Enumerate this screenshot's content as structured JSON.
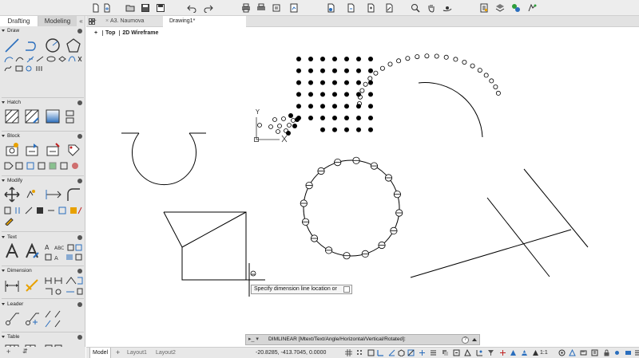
{
  "workspace_tabs": [
    "Drafting",
    "Modeling"
  ],
  "workspace_more": "«",
  "palette_sections": [
    "Draw",
    "Hatch",
    "Block",
    "Modify",
    "Text",
    "Dimension",
    "Leader",
    "Table"
  ],
  "doc_tabs": [
    {
      "label": "A3. Naumova",
      "active": false
    },
    {
      "label": "Drawing1*",
      "active": true
    }
  ],
  "doc_add": "+",
  "viewport": {
    "plus": "+",
    "view": "Top",
    "style": "2D Wireframe"
  },
  "ucs": {
    "y": "Y",
    "x": "X"
  },
  "tooltip": {
    "text": "Specify dimension line location or"
  },
  "command": {
    "prompt": "▸_ ▾",
    "text": "DIMLINEAR [Mtext/Text/Angle/Horizontal/Vertical/Rotated]:",
    "help": "?"
  },
  "layout_tabs": [
    "Model",
    "Layout1",
    "Layout2"
  ],
  "layout_add": "+",
  "palette_bottom": [
    "+",
    "⇵"
  ],
  "coordinates": "-20.8285, -413.7045, 0.0000",
  "zoom": "1:1",
  "colors": {
    "accent": "#2a6ebd",
    "ui_bg": "#e6e6e6"
  }
}
